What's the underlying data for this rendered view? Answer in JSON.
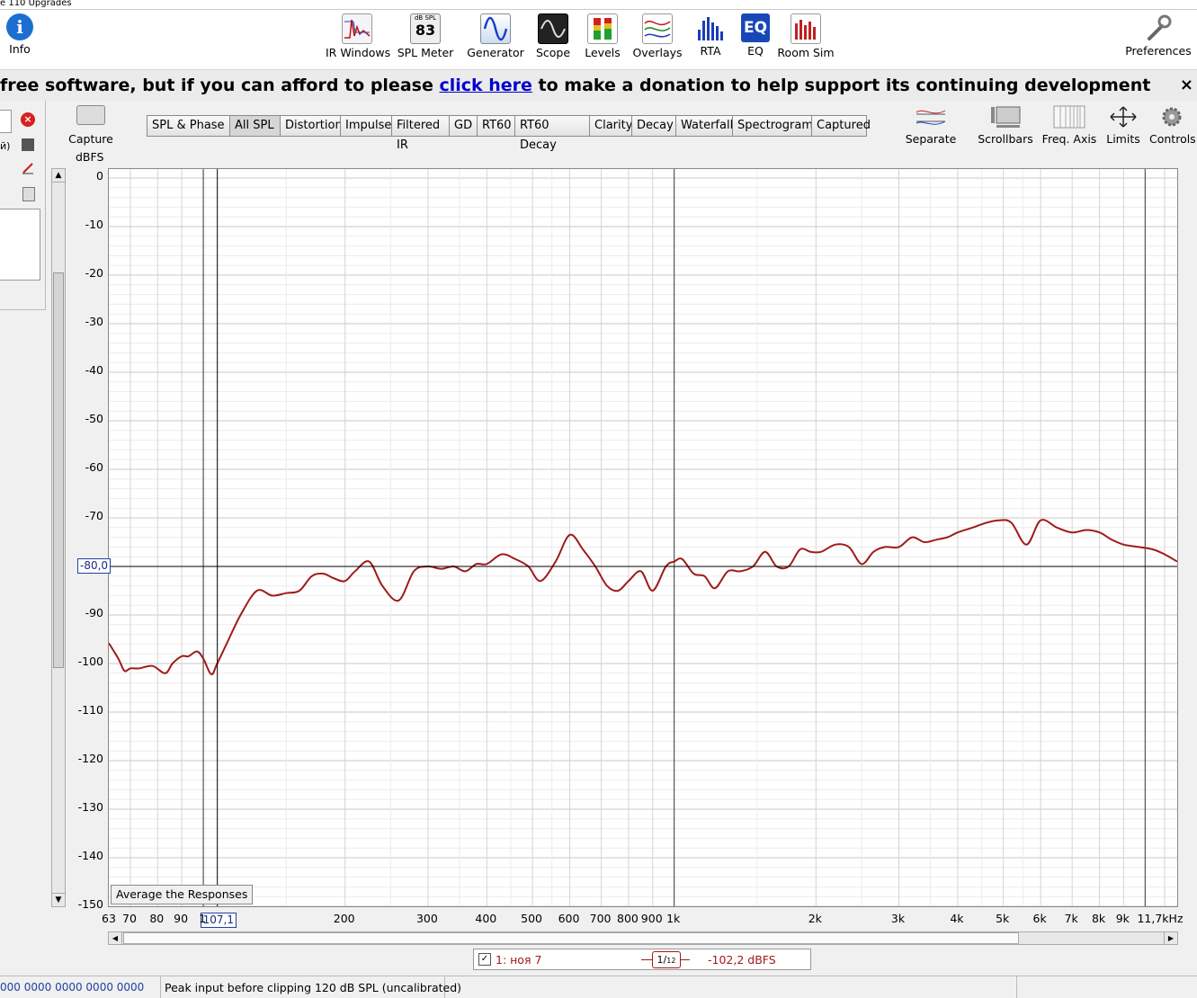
{
  "menubar": {
    "text": "e  110 Upgrades"
  },
  "toolbar": {
    "info": "Info",
    "items": [
      "IR Windows",
      "SPL Meter",
      "Generator",
      "Scope",
      "Levels",
      "Overlays",
      "RTA",
      "EQ",
      "Room Sim"
    ],
    "spl_badge_top": "dB SPL",
    "spl_badge_value": "83",
    "preferences": "Preferences"
  },
  "banner": {
    "before": "free software, but if you can afford to please ",
    "link": "click here",
    "after": " to make a donation to help support its continuing development",
    "close": "×"
  },
  "leftpanel": {
    "partial_label": "й)"
  },
  "capture": {
    "label": "Capture"
  },
  "tabs": [
    "SPL & Phase",
    "All SPL",
    "Distortion",
    "Impulse",
    "Filtered IR",
    "GD",
    "RT60",
    "RT60 Decay",
    "Clarity",
    "Decay",
    "Waterfall",
    "Spectrogram",
    "Captured"
  ],
  "selected_tab": "All SPL",
  "right_tools": [
    "Separate",
    "Scrollbars",
    "Freq. Axis",
    "Limits",
    "Controls"
  ],
  "chart_data": {
    "type": "line",
    "ylabel": "dBFS",
    "ylim": [
      -150,
      0
    ],
    "y_ticks": [
      "0",
      "-10",
      "-20",
      "-30",
      "-40",
      "-50",
      "-60",
      "-70",
      "-80",
      "-90",
      "-100",
      "-110",
      "-120",
      "-130",
      "-140",
      "-150"
    ],
    "x_scale": "log",
    "xlim": [
      63,
      11700
    ],
    "x_ticks": [
      {
        "v": 63,
        "t": "63"
      },
      {
        "v": 70,
        "t": "70"
      },
      {
        "v": 80,
        "t": "80"
      },
      {
        "v": 90,
        "t": "90"
      },
      {
        "v": 100,
        "t": "1"
      },
      {
        "v": 200,
        "t": "200"
      },
      {
        "v": 300,
        "t": "300"
      },
      {
        "v": 400,
        "t": "400"
      },
      {
        "v": 500,
        "t": "500"
      },
      {
        "v": 600,
        "t": "600"
      },
      {
        "v": 700,
        "t": "700"
      },
      {
        "v": 800,
        "t": "800"
      },
      {
        "v": 900,
        "t": "900"
      },
      {
        "v": 1000,
        "t": "1k"
      },
      {
        "v": 2000,
        "t": "2k"
      },
      {
        "v": 3000,
        "t": "3k"
      },
      {
        "v": 4000,
        "t": "4k"
      },
      {
        "v": 5000,
        "t": "5k"
      },
      {
        "v": 6000,
        "t": "6k"
      },
      {
        "v": 7000,
        "t": "7k"
      },
      {
        "v": 8000,
        "t": "8k"
      },
      {
        "v": 9000,
        "t": "9k"
      },
      {
        "v": 11700,
        "t": "11,7kHz"
      }
    ],
    "cursor": {
      "x": 107.1,
      "x_label": "107,1",
      "y": -80.0,
      "y_label": "-80,0"
    },
    "series": [
      {
        "name": "1: ноя 7",
        "color": "#a01a1a",
        "x": [
          63,
          66,
          68,
          70,
          73,
          78,
          83,
          86,
          90,
          93,
          97,
          100,
          104,
          107,
          112,
          120,
          130,
          140,
          150,
          160,
          170,
          180,
          190,
          200,
          210,
          225,
          240,
          260,
          280,
          300,
          320,
          340,
          360,
          380,
          400,
          430,
          460,
          490,
          520,
          560,
          600,
          640,
          680,
          720,
          760,
          800,
          850,
          900,
          960,
          1000,
          1040,
          1100,
          1160,
          1220,
          1300,
          1380,
          1470,
          1560,
          1650,
          1750,
          1850,
          1950,
          2050,
          2200,
          2350,
          2500,
          2650,
          2800,
          3000,
          3200,
          3400,
          3600,
          3800,
          4000,
          4300,
          4600,
          4900,
          5200,
          5600,
          6000,
          6500,
          7000,
          7500,
          8000,
          8500,
          9000,
          9700,
          10400,
          11000,
          11700
        ],
        "values": [
          -95.8,
          -99,
          -101.5,
          -101,
          -101,
          -100.5,
          -102,
          -100,
          -98.5,
          -98.5,
          -97.5,
          -99,
          -102.2,
          -100,
          -96,
          -90,
          -85,
          -86,
          -85.5,
          -85,
          -82,
          -81.5,
          -82.5,
          -83,
          -81,
          -79,
          -84,
          -87,
          -81,
          -80,
          -80.5,
          -80,
          -81,
          -79.5,
          -79.5,
          -77.5,
          -78.5,
          -80,
          -83,
          -79,
          -73.5,
          -76.5,
          -80,
          -84,
          -85,
          -83,
          -81,
          -85,
          -80,
          -79,
          -78.5,
          -81.5,
          -82,
          -84.5,
          -81,
          -81,
          -80,
          -77,
          -80,
          -80,
          -76.5,
          -77,
          -77,
          -75.5,
          -76,
          -79.5,
          -77,
          -76,
          -76,
          -74,
          -75,
          -74.5,
          -74,
          -73,
          -72,
          -71,
          -70.5,
          -71,
          -75.5,
          -70.5,
          -72,
          -73,
          -72.5,
          -73,
          -74.5,
          -75.5,
          -76,
          -76.5,
          -77.5,
          -79
        ]
      }
    ]
  },
  "average_button": "Average the Responses",
  "legend": {
    "checked": "✓",
    "name": "1: ноя 7",
    "smoothing_num": "1",
    "smoothing_den": "12",
    "value": "-102,2 dBFS"
  },
  "statusbar": {
    "left": "000  0000 0000  0000 0000",
    "message": "Peak input before clipping 120 dB SPL (uncalibrated)"
  }
}
